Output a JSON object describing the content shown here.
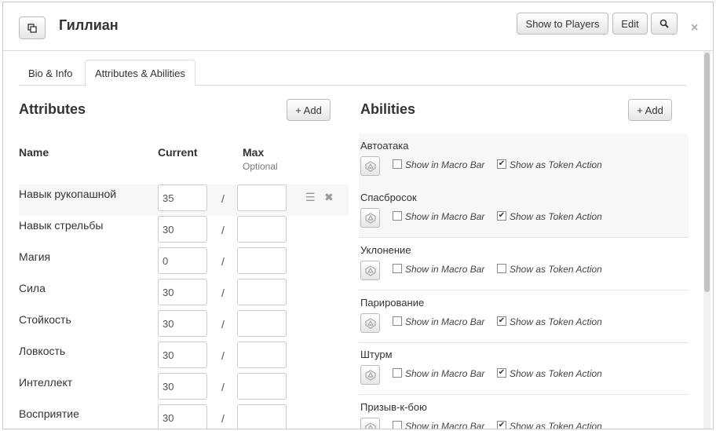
{
  "header": {
    "title": "Гиллиан",
    "show_to_players": "Show to Players",
    "edit": "Edit",
    "close": "×"
  },
  "tabs": [
    "Bio & Info",
    "Attributes & Abilities"
  ],
  "attributes": {
    "title": "Attributes",
    "add_label": "+ Add",
    "columns": {
      "name": "Name",
      "current": "Current",
      "max": "Max",
      "max_hint": "Optional"
    },
    "rows": [
      {
        "name": "Навык рукопашной",
        "current": "35",
        "max": ""
      },
      {
        "name": "Навык стрельбы",
        "current": "30",
        "max": ""
      },
      {
        "name": "Магия",
        "current": "0",
        "max": ""
      },
      {
        "name": "Сила",
        "current": "30",
        "max": ""
      },
      {
        "name": "Стойкость",
        "current": "30",
        "max": ""
      },
      {
        "name": "Ловкость",
        "current": "30",
        "max": ""
      },
      {
        "name": "Интеллект",
        "current": "30",
        "max": ""
      },
      {
        "name": "Восприятие",
        "current": "30",
        "max": ""
      }
    ],
    "separator": "/"
  },
  "abilities": {
    "title": "Abilities",
    "add_label": "+ Add",
    "macro_label": "Show in Macro Bar",
    "token_label": "Show as Token Action",
    "rows": [
      {
        "name": "Автоатака",
        "macro": false,
        "token": true
      },
      {
        "name": "Спасбросок",
        "macro": false,
        "token": true
      },
      {
        "name": "Уклонение",
        "macro": false,
        "token": false
      },
      {
        "name": "Парирование",
        "macro": false,
        "token": true
      },
      {
        "name": "Штурм",
        "macro": false,
        "token": true
      },
      {
        "name": "Призыв-к-бою",
        "macro": false,
        "token": true
      }
    ]
  }
}
